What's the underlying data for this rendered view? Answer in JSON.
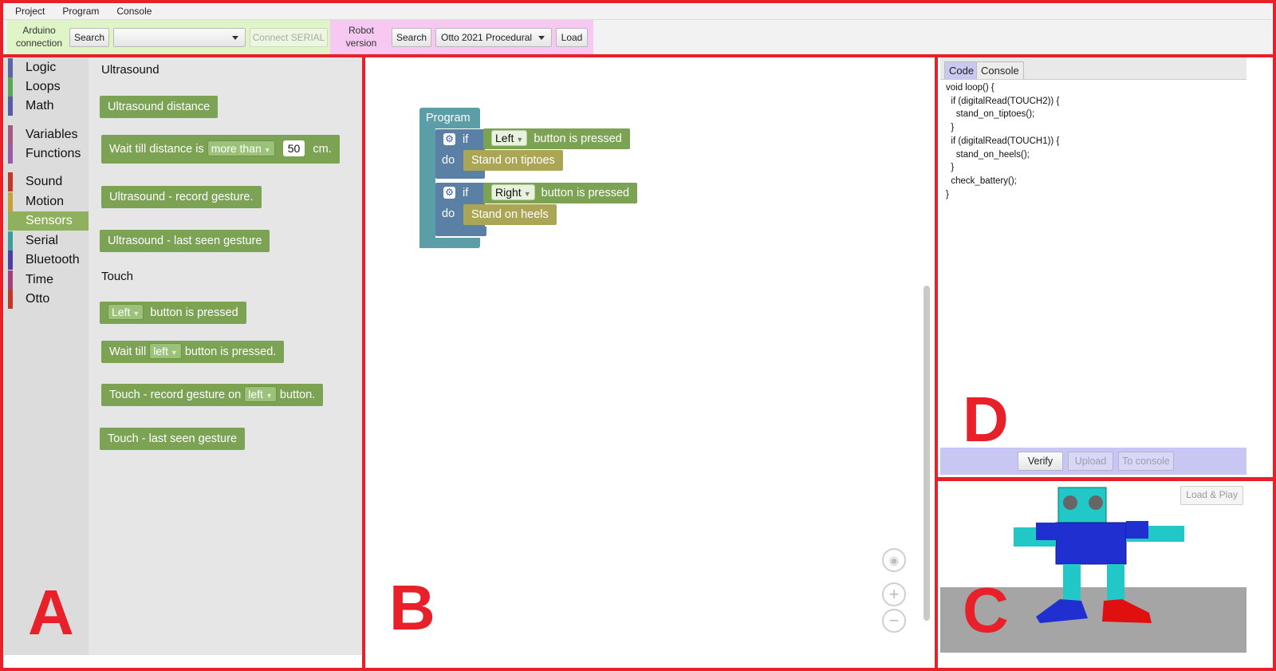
{
  "menu": [
    "Project",
    "Program",
    "Console"
  ],
  "toolbar": {
    "arduino_label": "Arduino\nconnection",
    "arduino_label_line1": "Arduino",
    "arduino_label_line2": "connection",
    "search_label": "Search",
    "port_value": "",
    "connect_label": "Connect SERIAL",
    "robot_label_line1": "Robot",
    "robot_label_line2": "version",
    "robot_search_label": "Search",
    "robot_version_value": "Otto 2021 Procedural",
    "load_label": "Load",
    "colors": {
      "arduino_bg": "#dff5c8",
      "robot_bg": "#f7c8f2"
    }
  },
  "categories": [
    {
      "label": "Logic",
      "color": "#5b67a5"
    },
    {
      "label": "Loops",
      "color": "#5ba55b"
    },
    {
      "label": "Math",
      "color": "#5b5ba5"
    },
    {
      "label": "Variables",
      "color": "#a55b80"
    },
    {
      "label": "Functions",
      "color": "#9a5ca6"
    },
    {
      "label": "Sound",
      "color": "#c0392b"
    },
    {
      "label": "Motion",
      "color": "#c8a03c"
    },
    {
      "label": "Sensors",
      "color": "#8fb15e",
      "selected": true
    },
    {
      "label": "Serial",
      "color": "#3f9c9c"
    },
    {
      "label": "Bluetooth",
      "color": "#4a3fa5"
    },
    {
      "label": "Time",
      "color": "#a53f7a"
    },
    {
      "label": "Otto",
      "color": "#c0392b"
    }
  ],
  "flyout": {
    "section_ultrasound": "Ultrasound",
    "us_distance": "Ultrasound distance",
    "wait_prefix": "Wait till distance is",
    "wait_op": "more than",
    "wait_value": "50",
    "wait_unit": "cm.",
    "us_record": "Ultrasound - record gesture.",
    "us_last": "Ultrasound - last seen gesture",
    "section_touch": "Touch",
    "touch_side": "Left",
    "touch_pressed": "button is pressed",
    "wait_till": "Wait till",
    "wait_till_side": "left",
    "wait_till_suffix": "button is pressed.",
    "touch_record_prefix": "Touch - record gesture on",
    "touch_record_side": "left",
    "touch_record_suffix": "button.",
    "touch_last": "Touch - last seen gesture"
  },
  "workspace": {
    "program_label": "Program",
    "if_label": "if",
    "do_label": "do",
    "cond1_side": "Left",
    "cond1_text": "button is pressed",
    "action1": "Stand on tiptoes",
    "cond2_side": "Right",
    "cond2_text": "button is pressed",
    "action2": "Stand on heels",
    "zoom_reset_icon": "target-icon",
    "zoom_in_symbol": "+",
    "zoom_out_symbol": "−"
  },
  "code_panel": {
    "tabs": [
      "Code",
      "Console"
    ],
    "code": "void loop() {\n  if (digitalRead(TOUCH2)) {\n    stand_on_tiptoes();\n  }\n  if (digitalRead(TOUCH1)) {\n    stand_on_heels();\n  }\n  check_battery();\n}",
    "verify_label": "Verify",
    "upload_label": "Upload",
    "to_console_label": "To console"
  },
  "simulator": {
    "load_play_label": "Load & Play"
  },
  "annotations": {
    "a": "A",
    "b": "B",
    "c": "C",
    "d": "D",
    "color": "#e8202a"
  }
}
